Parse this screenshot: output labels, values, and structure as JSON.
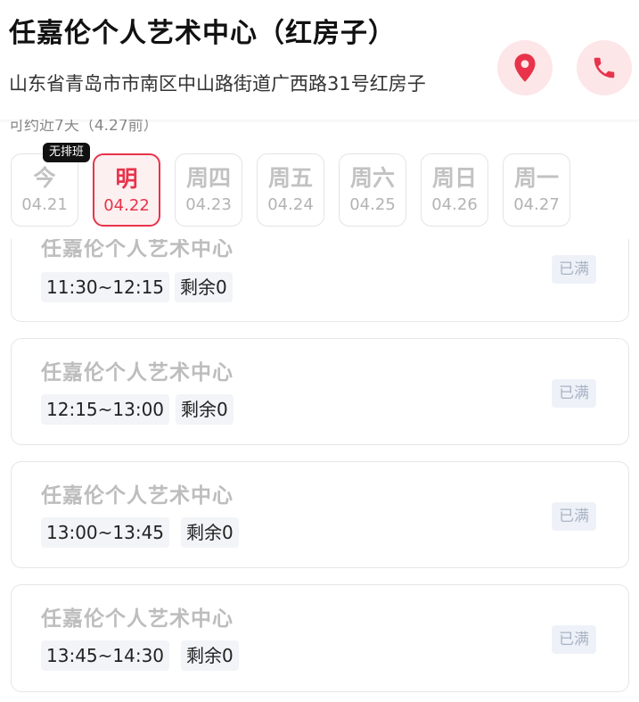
{
  "header": {
    "title": "任嘉伦个人艺术中心（红房子）",
    "address": "山东省青岛市市南区中山路街道广西路31号红房子",
    "accent_color": "#e8334a",
    "location_icon": "location-pin-icon",
    "phone_icon": "phone-icon"
  },
  "notice": "可约近7天（4.27前）",
  "dates": [
    {
      "weekday": "今",
      "date": "04.21",
      "state": "disabled",
      "badge": "无排班"
    },
    {
      "weekday": "明",
      "date": "04.22",
      "state": "selected"
    },
    {
      "weekday": "周四",
      "date": "04.23",
      "state": "disabled"
    },
    {
      "weekday": "周五",
      "date": "04.24",
      "state": "disabled"
    },
    {
      "weekday": "周六",
      "date": "04.25",
      "state": "disabled"
    },
    {
      "weekday": "周日",
      "date": "04.26",
      "state": "disabled"
    },
    {
      "weekday": "周一",
      "date": "04.27",
      "state": "disabled"
    }
  ],
  "slots": [
    {
      "name": "任嘉伦个人艺术中心",
      "time": "11:30~12:15",
      "remaining": "剩余0",
      "status": "已满"
    },
    {
      "name": "任嘉伦个人艺术中心",
      "time": "12:15~13:00",
      "remaining": "剩余0",
      "status": "已满"
    },
    {
      "name": "任嘉伦个人艺术中心",
      "time": "13:00~13:45",
      "remaining": "剩余0",
      "status": "已满"
    },
    {
      "name": "任嘉伦个人艺术中心",
      "time": "13:45~14:30",
      "remaining": "剩余0",
      "status": "已满"
    }
  ]
}
